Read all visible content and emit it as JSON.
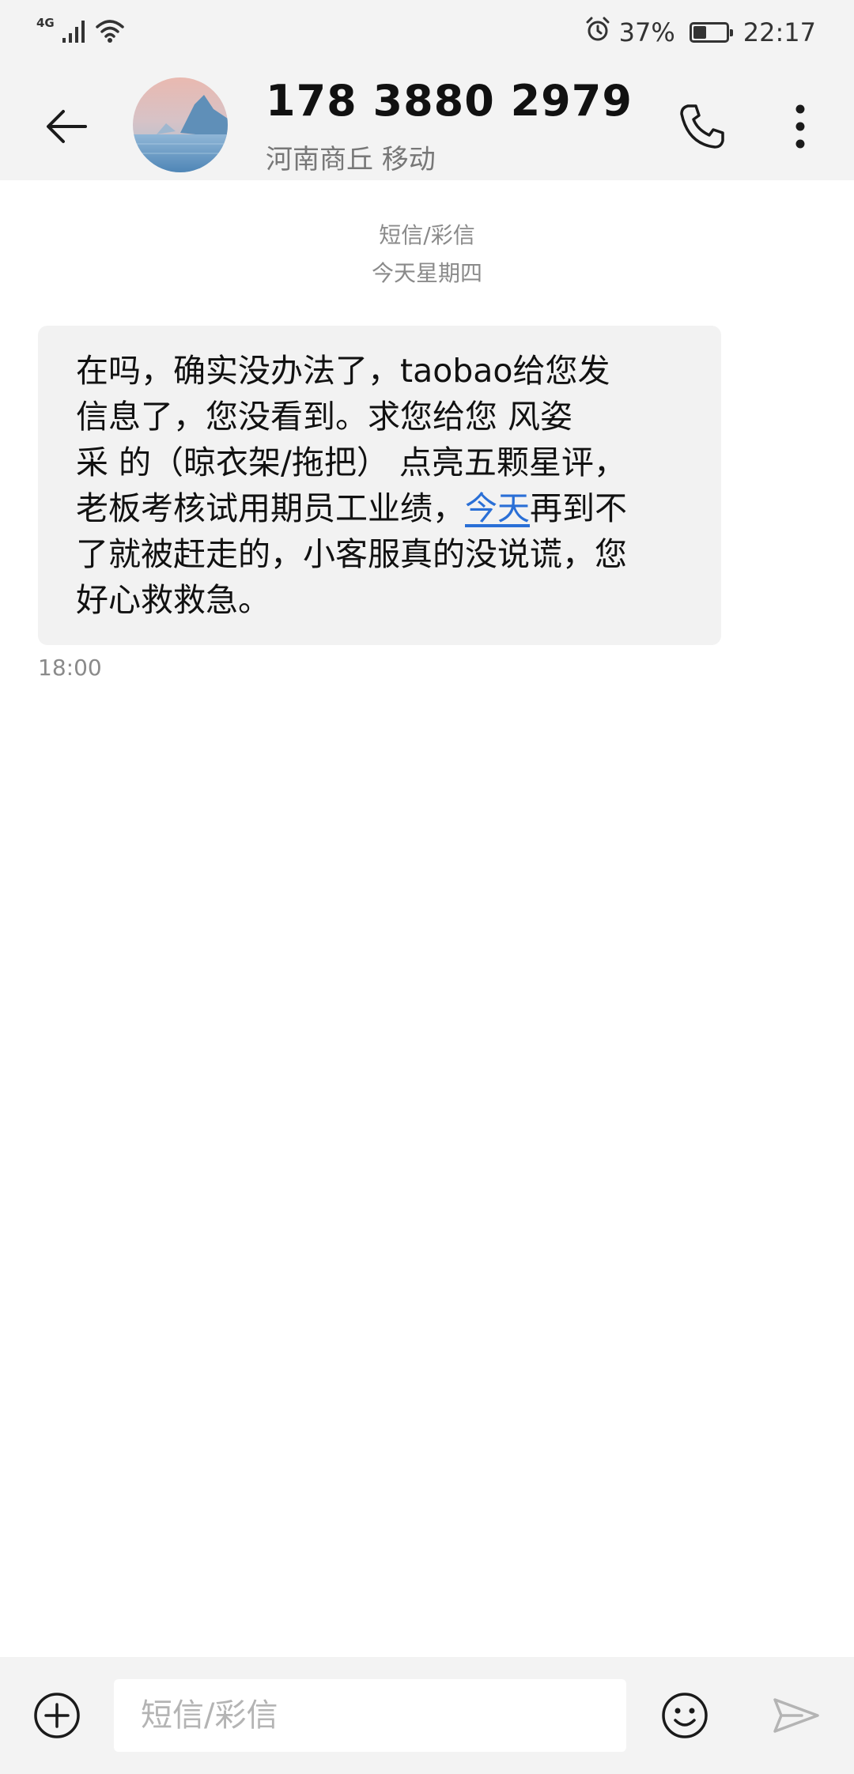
{
  "status_bar": {
    "network_type": "4G",
    "battery_percent": "37%",
    "battery_level": 0.37,
    "time": "22:17",
    "icons": [
      "signal-icon",
      "wifi-icon",
      "alarm-icon",
      "battery-icon"
    ]
  },
  "header": {
    "contact_number": "178 3880 2979",
    "contact_location": "河南商丘 移动",
    "icons": [
      "back-arrow-icon",
      "avatar",
      "phone-icon",
      "more-vertical-icon"
    ]
  },
  "conversation": {
    "message_type": "短信/彩信",
    "date_label": "今天星期四",
    "messages": [
      {
        "lines": [
          "在吗，确实没办法了，taobao给您发",
          "信息了，您没看到。求您给您 风姿",
          "采 的（晾衣架/拖把） 点亮五颗星评，"
        ],
        "line4_before_link": "老板考核试用期员工业绩，",
        "link_text": "今天",
        "line4_after_link": "再到不",
        "lines_after": [
          "了就被赶走的，小客服真的没说谎，您",
          "好心救救急。"
        ],
        "time": "18:00"
      }
    ]
  },
  "input_bar": {
    "placeholder": "短信/彩信",
    "value": "",
    "icons": [
      "add-circle-icon",
      "emoji-icon",
      "send-icon"
    ]
  },
  "colors": {
    "bar_background": "#f3f3f3",
    "bubble_background": "#f2f2f2",
    "link": "#2a6fd6",
    "muted_text": "#8a8a8a"
  }
}
